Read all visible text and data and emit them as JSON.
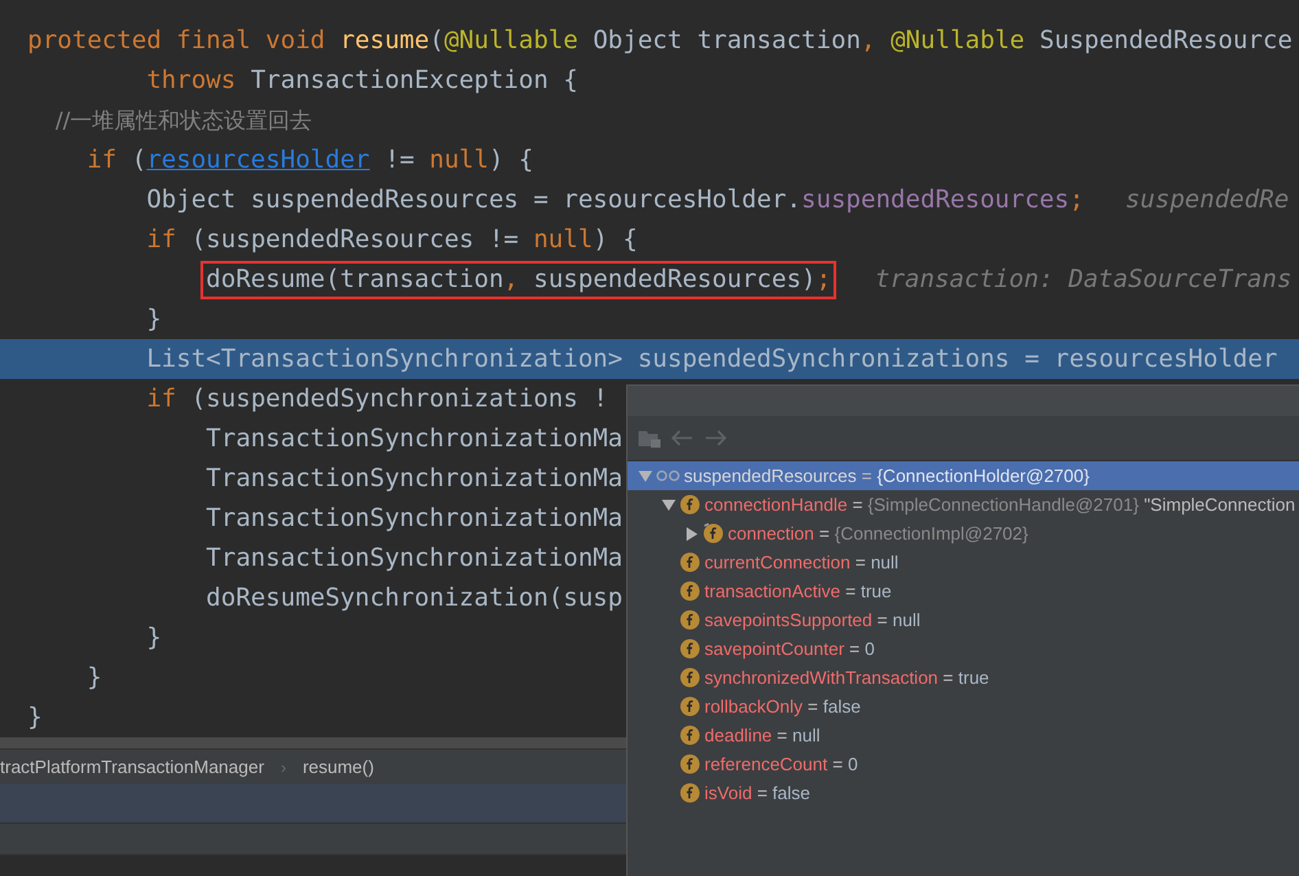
{
  "editor": {
    "lines": [
      {
        "code": [
          {
            "kind": "kw",
            "t": "protected final void "
          },
          {
            "kind": "method",
            "t": "resume"
          },
          {
            "kind": "plain",
            "t": "("
          },
          {
            "kind": "annot",
            "t": "@Nullable"
          },
          {
            "kind": "plain",
            "t": " Object transaction"
          },
          {
            "kind": "kw",
            "t": ", "
          },
          {
            "kind": "annot",
            "t": "@Nullable"
          },
          {
            "kind": "plain",
            "t": " SuspendedResource"
          }
        ]
      },
      {
        "code": [
          {
            "kind": "kw",
            "t": "        throws "
          },
          {
            "kind": "plain",
            "t": "TransactionException {"
          }
        ]
      },
      {
        "code": [
          {
            "kind": "comment",
            "t": "    //一堆属性和状态设置回去"
          }
        ]
      },
      {
        "code": [
          {
            "kind": "kw",
            "t": "    if "
          },
          {
            "kind": "plain",
            "t": "("
          },
          {
            "kind": "link",
            "t": "resourcesHolder"
          },
          {
            "kind": "plain",
            "t": " != "
          },
          {
            "kind": "kw",
            "t": "null"
          },
          {
            "kind": "plain",
            "t": ") {"
          }
        ]
      },
      {
        "code": [
          {
            "kind": "plain",
            "t": "        Object suspendedResources = resourcesHolder."
          },
          {
            "kind": "field",
            "t": "suspendedResources"
          },
          {
            "kind": "kw",
            "t": ";"
          }
        ],
        "hint": "suspendedRe"
      },
      {
        "code": [
          {
            "kind": "kw",
            "t": "        if "
          },
          {
            "kind": "plain",
            "t": "(suspendedResources != "
          },
          {
            "kind": "kw",
            "t": "null"
          },
          {
            "kind": "plain",
            "t": ") {"
          }
        ]
      },
      {
        "boxed": true,
        "code": [
          {
            "kind": "plain",
            "t": "            doResume(transaction"
          },
          {
            "kind": "kw",
            "t": ","
          },
          {
            "kind": "plain",
            "t": " suspendedResources)"
          },
          {
            "kind": "kw",
            "t": ";"
          }
        ],
        "hint": "transaction: DataSourceTrans"
      },
      {
        "code": [
          {
            "kind": "plain",
            "t": "        }"
          }
        ]
      },
      {
        "current": true,
        "code": [
          {
            "kind": "plain",
            "t": "        List<TransactionSynchronization> suspendedSynchronizations = resourcesHolder"
          }
        ]
      },
      {
        "code": [
          {
            "kind": "kw",
            "t": "        if "
          },
          {
            "kind": "plain",
            "t": "(suspendedSynchronizations !"
          }
        ]
      },
      {
        "code": [
          {
            "kind": "plain",
            "t": "            TransactionSynchronizationMa"
          }
        ]
      },
      {
        "code": [
          {
            "kind": "plain",
            "t": "            TransactionSynchronizationMa"
          }
        ]
      },
      {
        "code": [
          {
            "kind": "plain",
            "t": "            TransactionSynchronizationMa"
          }
        ]
      },
      {
        "code": [
          {
            "kind": "plain",
            "t": "            TransactionSynchronizationMa"
          }
        ]
      },
      {
        "code": [
          {
            "kind": "plain",
            "t": "            doResumeSynchronization(susp"
          }
        ]
      },
      {
        "code": [
          {
            "kind": "plain",
            "t": "        }"
          }
        ]
      },
      {
        "code": [
          {
            "kind": "plain",
            "t": "    }"
          }
        ]
      },
      {
        "code": [
          {
            "kind": "plain",
            "t": "}"
          }
        ]
      }
    ]
  },
  "breadcrumb": {
    "separator": "›",
    "items": [
      "tractPlatformTransactionManager",
      "resume()"
    ]
  },
  "popup": {
    "tree": [
      {
        "kind": "watch",
        "name": "suspendedResources",
        "op": "=",
        "value": {
          "kind": "object",
          "t": "{ConnectionHolder@2700}"
        },
        "selected": true,
        "expanded": true,
        "children": [
          {
            "kind": "field",
            "name": "connectionHandle",
            "op": "=",
            "value": {
              "kind": "object",
              "t": "{SimpleConnectionHandle@2701}"
            },
            "text": "\"SimpleConnection",
            "selected": false,
            "expanded": true,
            "children": [
              {
                "kind": "field",
                "name": "connection",
                "op": "=",
                "value": {
                  "kind": "object",
                  "t": "{ConnectionImpl@2702}"
                },
                "selected": false,
                "expanded": false
              }
            ]
          },
          {
            "kind": "field",
            "name": "currentConnection",
            "op": "=",
            "value": {
              "kind": "primitive",
              "t": "null"
            },
            "selected": false
          },
          {
            "kind": "field",
            "name": "transactionActive",
            "op": "=",
            "value": {
              "kind": "primitive",
              "t": "true"
            },
            "selected": false
          },
          {
            "kind": "field",
            "name": "savepointsSupported",
            "op": "=",
            "value": {
              "kind": "primitive",
              "t": "null"
            },
            "selected": false
          },
          {
            "kind": "field",
            "name": "savepointCounter",
            "op": "=",
            "value": {
              "kind": "primitive",
              "t": "0"
            },
            "selected": false
          },
          {
            "kind": "field",
            "name": "synchronizedWithTransaction",
            "op": "=",
            "value": {
              "kind": "primitive",
              "t": "true"
            },
            "selected": false
          },
          {
            "kind": "field",
            "name": "rollbackOnly",
            "op": "=",
            "value": {
              "kind": "primitive",
              "t": "false"
            },
            "selected": false
          },
          {
            "kind": "field",
            "name": "deadline",
            "op": "=",
            "value": {
              "kind": "primitive",
              "t": "null"
            },
            "selected": false
          },
          {
            "kind": "field",
            "name": "referenceCount",
            "op": "=",
            "value": {
              "kind": "primitive",
              "t": "0"
            },
            "selected": false
          },
          {
            "kind": "field",
            "name": "isVoid",
            "op": "=",
            "value": {
              "kind": "primitive",
              "t": "false"
            },
            "selected": false
          }
        ]
      }
    ]
  }
}
